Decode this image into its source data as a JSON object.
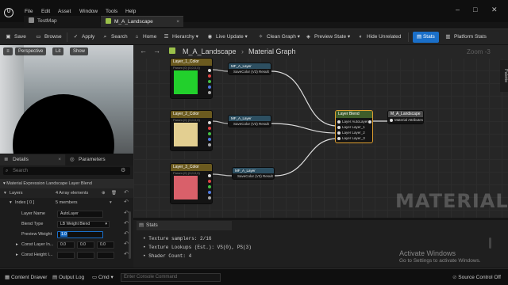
{
  "menu": [
    "File",
    "Edit",
    "Asset",
    "Window",
    "Tools",
    "Help"
  ],
  "tabs": [
    {
      "label": "TestMap",
      "active": false
    },
    {
      "label": "M_A_Landscape",
      "active": true
    }
  ],
  "toolbar": {
    "save": "Save",
    "browse": "Browse",
    "apply": "Apply",
    "search": "Search",
    "home": "Home",
    "hierarchy": "Hierarchy",
    "live_update": "Live Update",
    "clean_graph": "Clean Graph",
    "preview_state": "Preview State",
    "hide_unrelated": "Hide Unrelated",
    "stats": "Stats",
    "platform_stats": "Platform Stats"
  },
  "viewport": {
    "perspective": "Perspective",
    "lit": "Lit",
    "show": "Show"
  },
  "details": {
    "tab_details": "Details",
    "tab_parameters": "Parameters",
    "search_placeholder": "Search",
    "section_title": "Material Expression Landscape Layer Blend",
    "layers_label": "Layers",
    "layers_value": "4 Array elements",
    "index_label": "Index [ 0 ]",
    "index_value": "5 members",
    "layer_name_label": "Layer Name",
    "layer_name_value": "AutoLayer",
    "blend_type_label": "Blend Type",
    "blend_type_value": "LB Weight Blend",
    "preview_weight_label": "Preview Weight",
    "preview_weight_value": "1.0",
    "const_layer_label": "Const Layer In...",
    "const_layer_x": "0.0",
    "const_layer_y": "0.0",
    "const_layer_z": "0.0",
    "const_height_label": "Const Height I..."
  },
  "graph": {
    "breadcrumb_root": "M_A_Landscape",
    "breadcrumb_child": "Material Graph",
    "zoom": "Zoom -3",
    "watermark": "MATERIAL",
    "palette": "Palette",
    "nodes": {
      "layer1_title": "Layer_1_Color",
      "layer1_sub": "Param (0) (0,0,0,0)",
      "layer2_title": "Layer_2_Color",
      "layer2_sub": "Param (0) (0,0,0,0)",
      "layer3_title": "Layer_3_Color",
      "layer3_sub": "Param (0) (0,0,0,0)",
      "mf1_title": "MF_A_Layer",
      "mf2_title": "MF_A_Layer",
      "mf3_title": "MF_A_Layer",
      "mf_pin_out": "SaveColor (V3) Result",
      "blend_title": "Layer Blend",
      "blend_pins": [
        "Layer AutoLayer",
        "Layer Layer_1",
        "Layer Layer_2",
        "Layer Layer_3"
      ],
      "output_title": "M_A_Landscape",
      "output_pin": "Material Attributes"
    }
  },
  "colors": {
    "layer1": "#22d02c",
    "layer2": "#e3cf91",
    "layer3": "#d9606a",
    "accent": "#1a6fc9"
  },
  "stats": {
    "tab": "Stats",
    "lines": [
      "Texture samplers: 2/16",
      "Texture Lookups (Est.): VS(0), PS(3)",
      "Shader Count: 4"
    ]
  },
  "windows_watermark": {
    "line1": "Activate Windows",
    "line2": "Go to Settings to activate Windows."
  },
  "statusbar": {
    "content_drawer": "Content Drawer",
    "output_log": "Output Log",
    "cmd": "Cmd",
    "console_placeholder": "Enter Console Command",
    "source_control": "Source Control Off"
  }
}
